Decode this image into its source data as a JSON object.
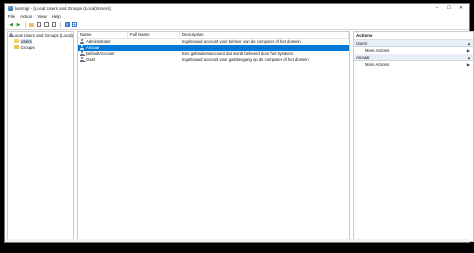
{
  "window": {
    "title": "lusrmgr - [Local Users and Groups (Local)\\Users]",
    "controls": [
      "–",
      "☐",
      "✕"
    ]
  },
  "menu": [
    "File",
    "Action",
    "View",
    "Help"
  ],
  "toolbar": {
    "icons": [
      "back-arrow-icon",
      "forward-arrow-icon",
      "folder-up-icon",
      "properties-icon",
      "export-list-icon",
      "refresh-icon",
      "help-icon",
      "show-hide-pane-icon"
    ]
  },
  "tree": {
    "root": "Local Users and Groups (Local)",
    "children": [
      "Users",
      "Groups"
    ]
  },
  "table": {
    "headers": {
      "name": "Name",
      "full_name": "Full Name",
      "description": "Description"
    },
    "rows": [
      {
        "name": "Administrator",
        "full_name": "",
        "description": "Ingebouwd account voor beheer van de computer of het domein"
      },
      {
        "name": "Anouar",
        "full_name": "",
        "description": ""
      },
      {
        "name": "DefaultAccount",
        "full_name": "",
        "description": "Een gebruikersaccount dat wordt beheerd door het systeem."
      },
      {
        "name": "Gast",
        "full_name": "",
        "description": "Ingebouwd account voor gasttoegang op de computer of het domein"
      }
    ],
    "selected_index": 1
  },
  "actions": {
    "title": "Actions",
    "sections": [
      {
        "label": "Users",
        "items": [
          "More Actions"
        ]
      },
      {
        "label": "Anouar",
        "items": [
          "More Actions"
        ]
      }
    ]
  }
}
